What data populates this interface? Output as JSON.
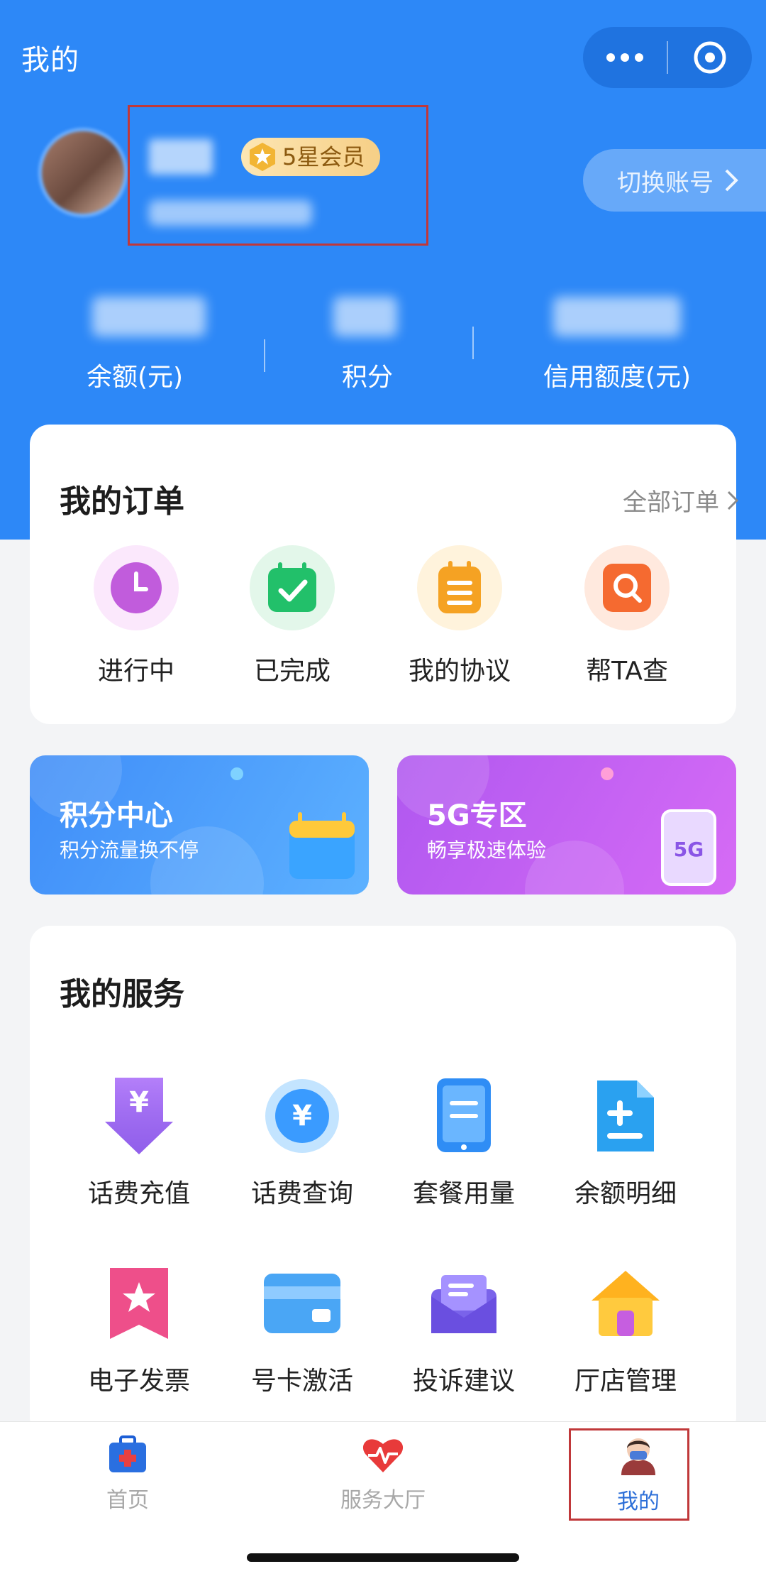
{
  "header": {
    "title": "我的"
  },
  "profile": {
    "member_badge": "5星会员",
    "switch_account": "切换账号"
  },
  "stats": [
    {
      "label": "余额(元)"
    },
    {
      "label": "积分"
    },
    {
      "label": "信用额度(元)"
    }
  ],
  "orders": {
    "title": "我的订单",
    "all_link": "全部订单",
    "items": [
      {
        "label": "进行中",
        "icon": "clock-icon"
      },
      {
        "label": "已完成",
        "icon": "calendar-check-icon"
      },
      {
        "label": "我的协议",
        "icon": "notepad-icon"
      },
      {
        "label": "帮TA查",
        "icon": "magnifier-icon"
      }
    ]
  },
  "promos": [
    {
      "title": "积分中心",
      "subtitle": "积分流量换不停"
    },
    {
      "title": "5G专区",
      "subtitle": "畅享极速体验",
      "icon_text": "5G"
    }
  ],
  "services": {
    "title": "我的服务",
    "items": [
      {
        "label": "话费充值",
        "icon": "yuan-down-arrow-icon"
      },
      {
        "label": "话费查询",
        "icon": "yuan-coin-icon"
      },
      {
        "label": "套餐用量",
        "icon": "phone-list-icon"
      },
      {
        "label": "余额明细",
        "icon": "document-plus-icon"
      },
      {
        "label": "电子发票",
        "icon": "star-bookmark-icon"
      },
      {
        "label": "号卡激活",
        "icon": "card-icon"
      },
      {
        "label": "投诉建议",
        "icon": "envelope-icon"
      },
      {
        "label": "厅店管理",
        "icon": "house-icon"
      }
    ],
    "yuan_symbol": "¥"
  },
  "tabbar": {
    "items": [
      {
        "label": "首页",
        "icon": "medical-kit-icon",
        "active": false
      },
      {
        "label": "服务大厅",
        "icon": "heart-pulse-icon",
        "active": false
      },
      {
        "label": "我的",
        "icon": "user-avatar-icon",
        "active": true
      }
    ]
  },
  "colors": {
    "primary": "#2d88f7",
    "active_tab": "#2d6fd8",
    "highlight_box": "#c0383a"
  }
}
